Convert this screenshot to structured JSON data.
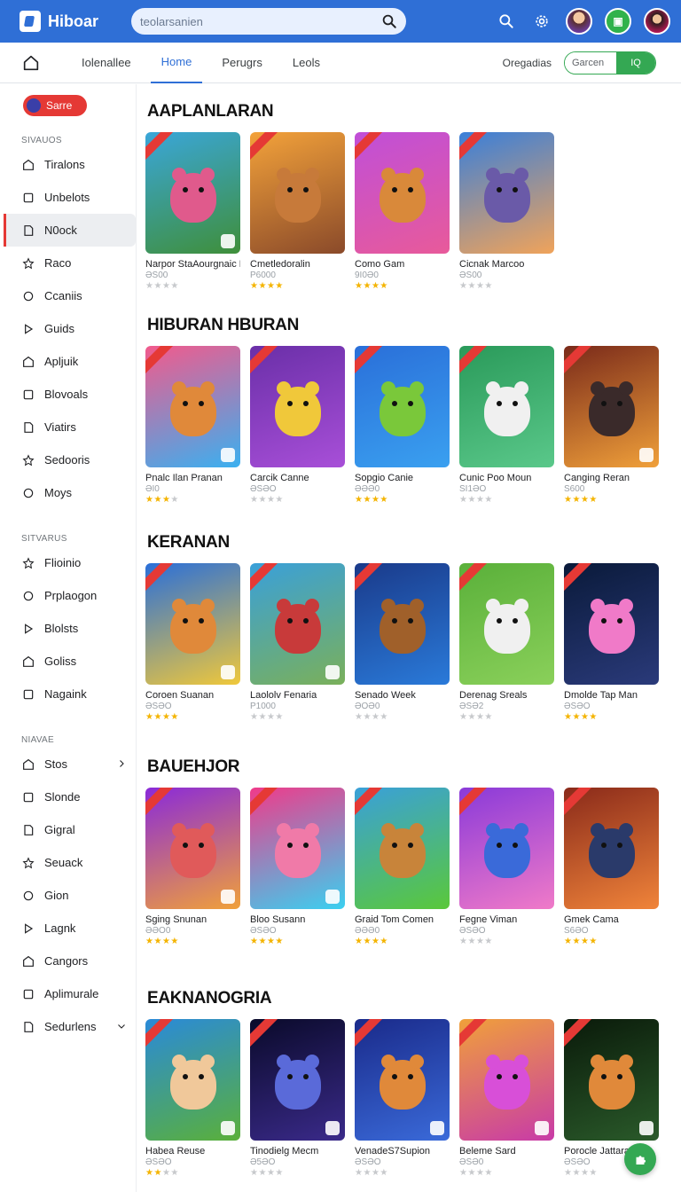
{
  "app": {
    "name": "Hiboar"
  },
  "search": {
    "placeholder": "teolarsanien"
  },
  "tabs": {
    "items": [
      "Iolenallee",
      "Home",
      "Perugrs",
      "Leols"
    ],
    "right_label": "Oregadias",
    "toggle_left": "Garcen",
    "toggle_right": "IQ"
  },
  "sidebar": {
    "cta_label": "Sarre",
    "sections": [
      {
        "title": "SIVAUOS",
        "items": [
          "Tiralons",
          "Unbelots",
          "N0ock",
          "Raco",
          "Ccaniis",
          "Guids",
          "Apljuik",
          "Blovoals",
          "Viatirs",
          "Sedooris",
          "Moys"
        ]
      },
      {
        "title": "SITVARUS",
        "items": [
          "Flioinio",
          "Prplaogon",
          "Blolsts",
          "Goliss",
          "Nagaink"
        ]
      },
      {
        "title": "NIAVAE",
        "items": [
          "Stos",
          "Slonde",
          "Gigral",
          "Seuack",
          "Gion",
          "Lagnk",
          "Cangors",
          "Aplimurale",
          "Sedurlens"
        ]
      }
    ]
  },
  "sections": [
    {
      "title": "AAPLANLARAN",
      "games": [
        {
          "name": "Narpor StaAourgnaic Blhlit",
          "sub": "ƏS00",
          "rating": 0,
          "c1": "#3aa6d9",
          "c2": "#3f8f3a",
          "creature": "#e05a8c",
          "badge": true
        },
        {
          "name": "Cmetledoralin",
          "sub": "P6000",
          "rating": 4,
          "c1": "#f3a23a",
          "c2": "#8a4a2a",
          "creature": "#c77a3a",
          "badge": false
        },
        {
          "name": "Como Gam",
          "sub": "9I0Ə0",
          "rating": 4,
          "c1": "#c04fd8",
          "c2": "#e85a9a",
          "creature": "#d9893a",
          "badge": false
        },
        {
          "name": "Cicnak Marcoo",
          "sub": "ƏS00",
          "rating": 0,
          "c1": "#3a7fd9",
          "c2": "#f0a35a",
          "creature": "#6a5aa8",
          "badge": false
        }
      ]
    },
    {
      "title": "HIBURAN HBURAN",
      "games": [
        {
          "name": "Pnalc Ilan Pranan",
          "sub": "ƏI0",
          "rating": 3,
          "c1": "#f25a8c",
          "c2": "#3ab0f0",
          "creature": "#e0893a",
          "badge": true
        },
        {
          "name": "Carcik Canne",
          "sub": "ƏSƏO",
          "rating": 0,
          "c1": "#6a2fa8",
          "c2": "#a84fd8",
          "creature": "#f0c83a",
          "badge": false
        },
        {
          "name": "Sopgio Canie",
          "sub": "ƏƏƏ0",
          "rating": 4,
          "c1": "#2a6fd9",
          "c2": "#3aa0f0",
          "creature": "#7ac83a",
          "badge": false
        },
        {
          "name": "Cunic Poo Moun",
          "sub": "SI1ƏO",
          "rating": 0,
          "c1": "#2a9a5a",
          "c2": "#5ac88a",
          "creature": "#f0f0f0",
          "badge": false
        },
        {
          "name": "Canging Reran",
          "sub": "S600",
          "rating": 4,
          "c1": "#7a2a1a",
          "c2": "#f0a03a",
          "creature": "#3a2a2a",
          "badge": true
        }
      ]
    },
    {
      "title": "KERANAN",
      "games": [
        {
          "name": "Coroen Suanan",
          "sub": "ƏSƏO",
          "rating": 4,
          "c1": "#2a6fd9",
          "c2": "#f0c83a",
          "creature": "#e0893a",
          "badge": true
        },
        {
          "name": "Laololv Fenaria",
          "sub": "P1000",
          "rating": 0,
          "c1": "#3aa0d9",
          "c2": "#7ab05a",
          "creature": "#c83a3a",
          "badge": true
        },
        {
          "name": "Senado Week",
          "sub": "ƏOƏ0",
          "rating": 0,
          "c1": "#1a3a8a",
          "c2": "#2a7ad9",
          "creature": "#a0602a",
          "badge": false
        },
        {
          "name": "Derenag Sreals",
          "sub": "ƏSƏ2",
          "rating": 0,
          "c1": "#5ab03a",
          "c2": "#8ad05a",
          "creature": "#f0f0f0",
          "badge": false
        },
        {
          "name": "Dmolde Tap Man",
          "sub": "ƏSƏO",
          "rating": 4,
          "c1": "#0a1a3a",
          "c2": "#2a3a7a",
          "creature": "#f07ac8",
          "badge": false
        }
      ]
    },
    {
      "title": "BAUEHJOR",
      "games": [
        {
          "name": "Sging Snunan",
          "sub": "ƏƏO0",
          "rating": 4,
          "c1": "#8a2ad9",
          "c2": "#f0a03a",
          "creature": "#e05a5a",
          "badge": true
        },
        {
          "name": "Bloo Susann",
          "sub": "ƏSƏO",
          "rating": 4,
          "c1": "#f03a8a",
          "c2": "#3ad0f0",
          "creature": "#f07aa8",
          "badge": true
        },
        {
          "name": "Graid Tom Comen",
          "sub": "ƏƏƏ0",
          "rating": 4,
          "c1": "#3aa0d9",
          "c2": "#5ac83a",
          "creature": "#c8843a",
          "badge": false
        },
        {
          "name": "Fegne Viman",
          "sub": "ƏSƏO",
          "rating": 0,
          "c1": "#8a3ad9",
          "c2": "#f07ac8",
          "creature": "#3a6ad9",
          "badge": false
        },
        {
          "name": "Gmek Cama",
          "sub": "S6ƏO",
          "rating": 4,
          "c1": "#8a2a1a",
          "c2": "#f0843a",
          "creature": "#2a3a6a",
          "badge": false
        }
      ]
    },
    {
      "title": "EAKNANOGRIA",
      "games": [
        {
          "name": "Habea Reuse",
          "sub": "ƏSƏO",
          "rating": 2,
          "c1": "#2a8ad9",
          "c2": "#5ab03a",
          "creature": "#f0c89a",
          "badge": true
        },
        {
          "name": "Tinodielg Mecm",
          "sub": "Ə5ƏO",
          "rating": 0,
          "c1": "#0a0a2a",
          "c2": "#3a2a8a",
          "creature": "#5a6ad9",
          "badge": true
        },
        {
          "name": "VenadeS7Supion",
          "sub": "ƏSƏO",
          "rating": 0,
          "c1": "#1a2a8a",
          "c2": "#3a6ad9",
          "creature": "#e0893a",
          "badge": true
        },
        {
          "name": "Beleme Sard",
          "sub": "ƏSƏ0",
          "rating": 0,
          "c1": "#f0a03a",
          "c2": "#c83aa8",
          "creature": "#d84fd8",
          "badge": true
        },
        {
          "name": "Porocle Jattaral",
          "sub": "ƏSƏO",
          "rating": 0,
          "c1": "#0a1a0a",
          "c2": "#2a5a2a",
          "creature": "#e0893a",
          "badge": true
        }
      ]
    }
  ],
  "colors": {
    "topbar": "#2f6fd6",
    "accent": "#2f6fd6",
    "cta": "#e53935",
    "fab": "#34a853"
  }
}
